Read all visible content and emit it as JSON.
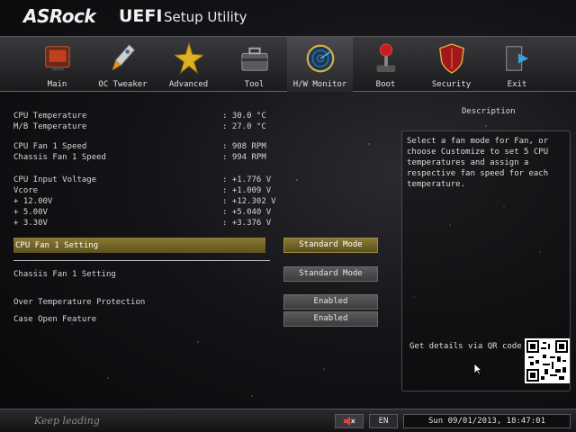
{
  "header": {
    "brand": "ASRock",
    "uefi": "UEFI",
    "subtitle": "Setup Utility"
  },
  "nav": {
    "active": "H/W Monitor",
    "tabs": [
      {
        "label": "Main",
        "icon": "main-icon"
      },
      {
        "label": "OC Tweaker",
        "icon": "rocket-icon"
      },
      {
        "label": "Advanced",
        "icon": "star-icon"
      },
      {
        "label": "Tool",
        "icon": "toolbox-icon"
      },
      {
        "label": "H/W Monitor",
        "icon": "radar-icon"
      },
      {
        "label": "Boot",
        "icon": "joystick-icon"
      },
      {
        "label": "Security",
        "icon": "shield-icon"
      },
      {
        "label": "Exit",
        "icon": "exit-door-icon"
      }
    ]
  },
  "monitor": {
    "cpu_temp": {
      "label": "CPU Temperature",
      "value": ": 30.0 °C"
    },
    "mb_temp": {
      "label": "M/B Temperature",
      "value": ": 27.0 °C"
    },
    "cpu_fan": {
      "label": "CPU Fan 1 Speed",
      "value": ": 908 RPM"
    },
    "chassis_fan": {
      "label": "Chassis Fan 1 Speed",
      "value": ": 994 RPM"
    },
    "cpu_vin": {
      "label": "CPU Input Voltage",
      "value": ": +1.776 V"
    },
    "vcore": {
      "label": "Vcore",
      "value": ": +1.009 V"
    },
    "v12": {
      "label": "+ 12.00V",
      "value": ": +12.302 V"
    },
    "v5": {
      "label": "+ 5.00V",
      "value": ": +5.040 V"
    },
    "v33": {
      "label": "+ 3.30V",
      "value": ": +3.376 V"
    }
  },
  "settings": {
    "cpu_fan_setting": {
      "label": "CPU Fan 1 Setting",
      "value": "Standard Mode"
    },
    "chassis_fan_setting": {
      "label": "Chassis Fan 1 Setting",
      "value": "Standard Mode"
    },
    "over_temp": {
      "label": "Over Temperature Protection",
      "value": "Enabled"
    },
    "case_open": {
      "label": "Case Open Feature",
      "value": "Enabled"
    }
  },
  "description": {
    "title": "Description",
    "text": "Select a fan mode for Fan, or choose Customize to set 5 CPU temperatures and assign a respective fan speed for each temperature.",
    "qr_label": "Get details via QR code"
  },
  "footer": {
    "tagline": "Keep leading",
    "language": "EN",
    "datetime": "Sun 09/01/2013, 18:47:01"
  },
  "colors": {
    "selection": "#8c7a32",
    "accent_gold": "#d4b040"
  }
}
